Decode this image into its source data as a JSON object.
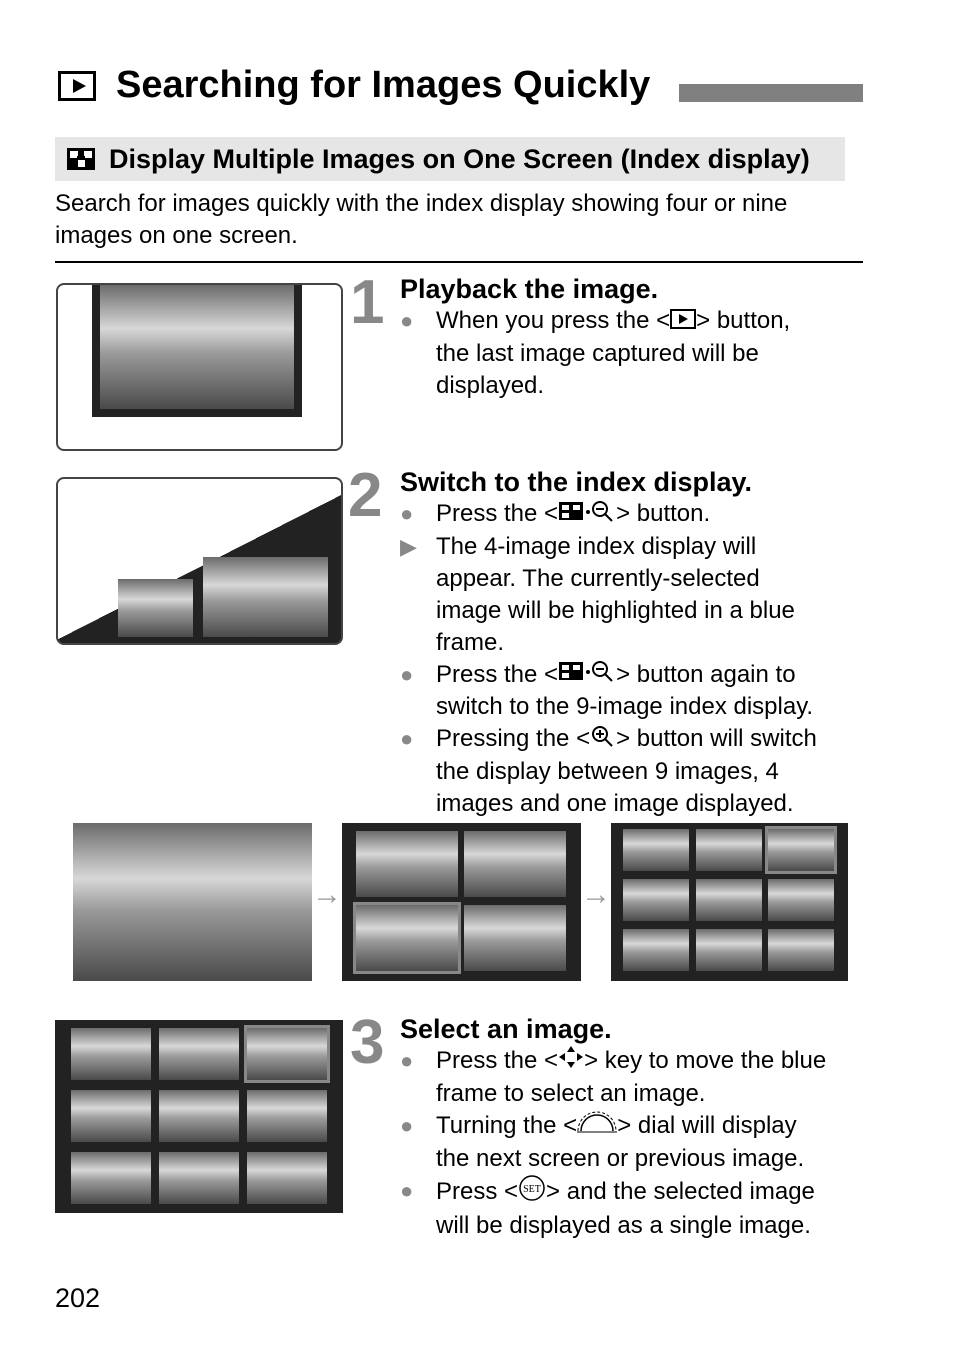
{
  "title": {
    "icon": "playback-icon",
    "text": "Searching for Images Quickly"
  },
  "subheading": {
    "icon": "index-grid-icon",
    "text": "Display Multiple Images on One Screen (Index display)"
  },
  "intro": "Search for images quickly with the index display showing four or nine images on one screen.",
  "steps": [
    {
      "number": "1",
      "title": "Playback the image.",
      "bullets": [
        {
          "marker": "circle",
          "pre": "When you press the <",
          "icon": "playback-icon",
          "post": "> button, the last image captured will be displayed."
        }
      ]
    },
    {
      "number": "2",
      "title": "Switch to the index display.",
      "bullets": [
        {
          "marker": "circle",
          "pre": "Press the <",
          "icon": "index-reduce-icon",
          "post": "> button."
        },
        {
          "marker": "triangle",
          "pre": "The 4-image index display will appear. The currently-selected image will be highlighted in a blue frame.",
          "icon": "",
          "post": ""
        },
        {
          "marker": "circle",
          "pre": "Press the <",
          "icon": "index-reduce-icon",
          "post": "> button again to switch to the 9-image index display."
        },
        {
          "marker": "circle",
          "pre": "Pressing the <",
          "icon": "magnify-icon",
          "post": "> button will switch the display between 9 images, 4 images and one image displayed."
        }
      ]
    },
    {
      "number": "3",
      "title": "Select an image.",
      "bullets": [
        {
          "marker": "circle",
          "pre": "Press the <",
          "icon": "cross-keys-icon",
          "post": "> key to move the blue frame to select an image."
        },
        {
          "marker": "circle",
          "pre": "Turning the <",
          "icon": "main-dial-icon",
          "post": "> dial will display the next screen or previous image."
        },
        {
          "marker": "circle",
          "pre": "Press <",
          "icon": "set-button-icon",
          "post": "> and the selected image will be displayed as a single image."
        }
      ]
    }
  ],
  "icon_labels": {
    "set": "SET"
  },
  "page_number": "202"
}
